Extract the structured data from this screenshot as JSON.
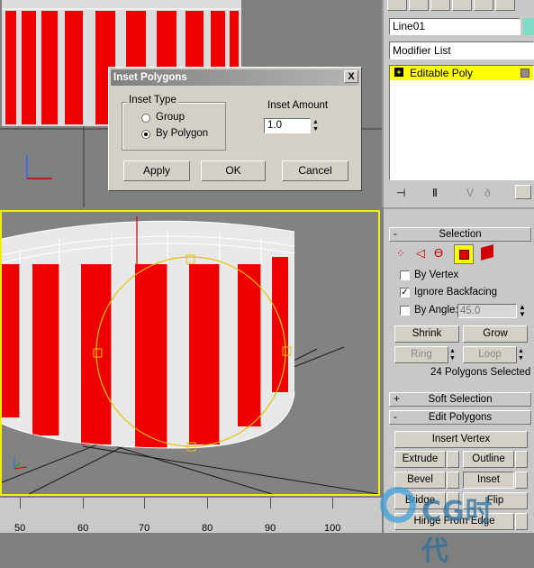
{
  "dialog": {
    "title": "Inset Polygons",
    "close": "X",
    "inset_type_label": "Inset Type",
    "options": [
      "Group",
      "By Polygon"
    ],
    "selected_option": "By Polygon",
    "inset_amount_label": "Inset Amount",
    "inset_amount_value": "1.0",
    "buttons": {
      "apply": "Apply",
      "ok": "OK",
      "cancel": "Cancel"
    }
  },
  "panel": {
    "object_name": "Line01",
    "modifier_list": "Modifier List",
    "stack_item": "Editable Poly",
    "stack_expand": "+",
    "selection_header": "Selection",
    "by_vertex": "By Vertex",
    "ignore_backfacing": "Ignore Backfacing",
    "by_angle": "By Angle:",
    "angle_value": "45.0",
    "shrink": "Shrink",
    "grow": "Grow",
    "ring": "Ring",
    "loop": "Loop",
    "selected_count": "24 Polygons Selected",
    "soft_selection_header": "Soft Selection",
    "soft_selection_toggle": "+",
    "edit_polygons_header": "Edit Polygons",
    "edit_polygons_toggle": "-",
    "selection_toggle": "-",
    "insert_vertex": "Insert Vertex",
    "extrude": "Extrude",
    "outline": "Outline",
    "bevel": "Bevel",
    "inset": "Inset",
    "bridge": "Bridge",
    "flip": "Flip",
    "hinge_from_edge": "Hinge From Edge"
  },
  "ruler": {
    "labels": [
      "50",
      "60",
      "70",
      "80",
      "90",
      "100"
    ]
  },
  "watermark": "CG时代",
  "colors": {
    "accent_selection": "#ffff00",
    "object_red": "#ee0000",
    "dialog_title": "#808080"
  }
}
